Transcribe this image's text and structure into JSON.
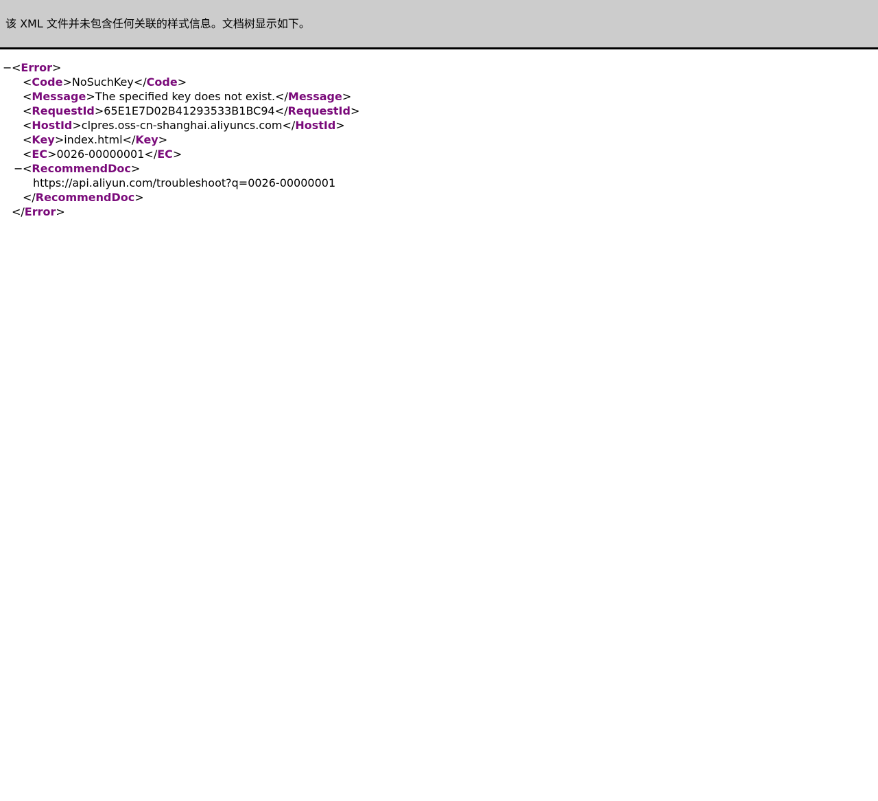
{
  "banner": {
    "text": "该 XML 文件并未包含任何关联的样式信息。文档树显示如下。"
  },
  "xml": {
    "root_tag": "Error",
    "collapse_glyph": "−",
    "elements": {
      "code": {
        "tag": "Code",
        "value": "NoSuchKey"
      },
      "message": {
        "tag": "Message",
        "value": "The specified key does not exist."
      },
      "request_id": {
        "tag": "RequestId",
        "value": "65E1E7D02B41293533B1BC94"
      },
      "host_id": {
        "tag": "HostId",
        "value": "clpres.oss-cn-shanghai.aliyuncs.com"
      },
      "key": {
        "tag": "Key",
        "value": "index.html"
      },
      "ec": {
        "tag": "EC",
        "value": "0026-00000001"
      },
      "recommend_doc": {
        "tag": "RecommendDoc",
        "value": "https://api.aliyun.com/troubleshoot?q=0026-00000001"
      }
    }
  },
  "colors": {
    "banner_bg": "#cccccc",
    "tag_name": "#7a0a7a",
    "text": "#000000"
  }
}
